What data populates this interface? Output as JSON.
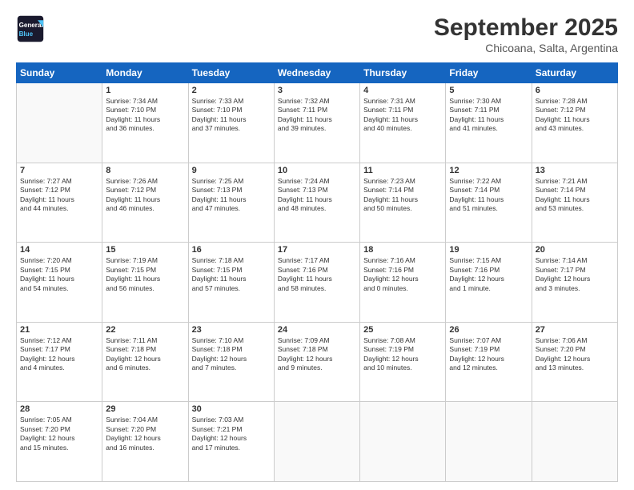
{
  "logo": {
    "line1": "General",
    "line2": "Blue"
  },
  "header": {
    "month": "September 2025",
    "location": "Chicoana, Salta, Argentina"
  },
  "weekdays": [
    "Sunday",
    "Monday",
    "Tuesday",
    "Wednesday",
    "Thursday",
    "Friday",
    "Saturday"
  ],
  "weeks": [
    [
      {
        "day": "",
        "info": ""
      },
      {
        "day": "1",
        "info": "Sunrise: 7:34 AM\nSunset: 7:10 PM\nDaylight: 11 hours\nand 36 minutes."
      },
      {
        "day": "2",
        "info": "Sunrise: 7:33 AM\nSunset: 7:10 PM\nDaylight: 11 hours\nand 37 minutes."
      },
      {
        "day": "3",
        "info": "Sunrise: 7:32 AM\nSunset: 7:11 PM\nDaylight: 11 hours\nand 39 minutes."
      },
      {
        "day": "4",
        "info": "Sunrise: 7:31 AM\nSunset: 7:11 PM\nDaylight: 11 hours\nand 40 minutes."
      },
      {
        "day": "5",
        "info": "Sunrise: 7:30 AM\nSunset: 7:11 PM\nDaylight: 11 hours\nand 41 minutes."
      },
      {
        "day": "6",
        "info": "Sunrise: 7:28 AM\nSunset: 7:12 PM\nDaylight: 11 hours\nand 43 minutes."
      }
    ],
    [
      {
        "day": "7",
        "info": "Sunrise: 7:27 AM\nSunset: 7:12 PM\nDaylight: 11 hours\nand 44 minutes."
      },
      {
        "day": "8",
        "info": "Sunrise: 7:26 AM\nSunset: 7:12 PM\nDaylight: 11 hours\nand 46 minutes."
      },
      {
        "day": "9",
        "info": "Sunrise: 7:25 AM\nSunset: 7:13 PM\nDaylight: 11 hours\nand 47 minutes."
      },
      {
        "day": "10",
        "info": "Sunrise: 7:24 AM\nSunset: 7:13 PM\nDaylight: 11 hours\nand 48 minutes."
      },
      {
        "day": "11",
        "info": "Sunrise: 7:23 AM\nSunset: 7:14 PM\nDaylight: 11 hours\nand 50 minutes."
      },
      {
        "day": "12",
        "info": "Sunrise: 7:22 AM\nSunset: 7:14 PM\nDaylight: 11 hours\nand 51 minutes."
      },
      {
        "day": "13",
        "info": "Sunrise: 7:21 AM\nSunset: 7:14 PM\nDaylight: 11 hours\nand 53 minutes."
      }
    ],
    [
      {
        "day": "14",
        "info": "Sunrise: 7:20 AM\nSunset: 7:15 PM\nDaylight: 11 hours\nand 54 minutes."
      },
      {
        "day": "15",
        "info": "Sunrise: 7:19 AM\nSunset: 7:15 PM\nDaylight: 11 hours\nand 56 minutes."
      },
      {
        "day": "16",
        "info": "Sunrise: 7:18 AM\nSunset: 7:15 PM\nDaylight: 11 hours\nand 57 minutes."
      },
      {
        "day": "17",
        "info": "Sunrise: 7:17 AM\nSunset: 7:16 PM\nDaylight: 11 hours\nand 58 minutes."
      },
      {
        "day": "18",
        "info": "Sunrise: 7:16 AM\nSunset: 7:16 PM\nDaylight: 12 hours\nand 0 minutes."
      },
      {
        "day": "19",
        "info": "Sunrise: 7:15 AM\nSunset: 7:16 PM\nDaylight: 12 hours\nand 1 minute."
      },
      {
        "day": "20",
        "info": "Sunrise: 7:14 AM\nSunset: 7:17 PM\nDaylight: 12 hours\nand 3 minutes."
      }
    ],
    [
      {
        "day": "21",
        "info": "Sunrise: 7:12 AM\nSunset: 7:17 PM\nDaylight: 12 hours\nand 4 minutes."
      },
      {
        "day": "22",
        "info": "Sunrise: 7:11 AM\nSunset: 7:18 PM\nDaylight: 12 hours\nand 6 minutes."
      },
      {
        "day": "23",
        "info": "Sunrise: 7:10 AM\nSunset: 7:18 PM\nDaylight: 12 hours\nand 7 minutes."
      },
      {
        "day": "24",
        "info": "Sunrise: 7:09 AM\nSunset: 7:18 PM\nDaylight: 12 hours\nand 9 minutes."
      },
      {
        "day": "25",
        "info": "Sunrise: 7:08 AM\nSunset: 7:19 PM\nDaylight: 12 hours\nand 10 minutes."
      },
      {
        "day": "26",
        "info": "Sunrise: 7:07 AM\nSunset: 7:19 PM\nDaylight: 12 hours\nand 12 minutes."
      },
      {
        "day": "27",
        "info": "Sunrise: 7:06 AM\nSunset: 7:20 PM\nDaylight: 12 hours\nand 13 minutes."
      }
    ],
    [
      {
        "day": "28",
        "info": "Sunrise: 7:05 AM\nSunset: 7:20 PM\nDaylight: 12 hours\nand 15 minutes."
      },
      {
        "day": "29",
        "info": "Sunrise: 7:04 AM\nSunset: 7:20 PM\nDaylight: 12 hours\nand 16 minutes."
      },
      {
        "day": "30",
        "info": "Sunrise: 7:03 AM\nSunset: 7:21 PM\nDaylight: 12 hours\nand 17 minutes."
      },
      {
        "day": "",
        "info": ""
      },
      {
        "day": "",
        "info": ""
      },
      {
        "day": "",
        "info": ""
      },
      {
        "day": "",
        "info": ""
      }
    ]
  ]
}
